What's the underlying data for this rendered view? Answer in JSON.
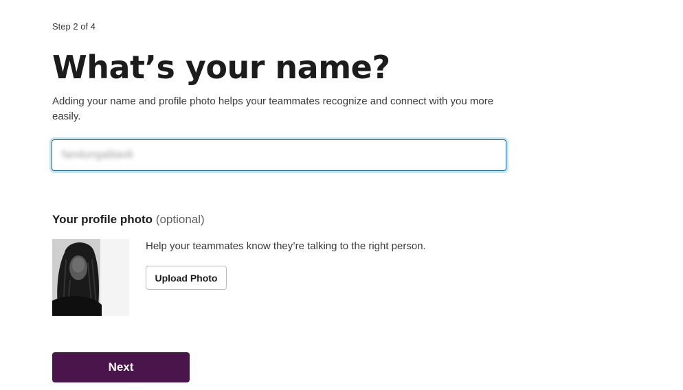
{
  "step": {
    "label": "Step 2 of 4"
  },
  "header": {
    "title": "What’s your name?",
    "subtitle": "Adding your name and profile photo helps your teammates recognize and connect with you more easily."
  },
  "name_field": {
    "value": "fandungalitaoli"
  },
  "profile_photo": {
    "heading": "Your profile photo",
    "optional_label": "(optional)",
    "help_text": "Help your teammates know they’re talking to the right person.",
    "upload_label": "Upload Photo"
  },
  "actions": {
    "next_label": "Next",
    "next_color": "#4a154b"
  },
  "colors": {
    "focus_border": "#1264a3"
  }
}
